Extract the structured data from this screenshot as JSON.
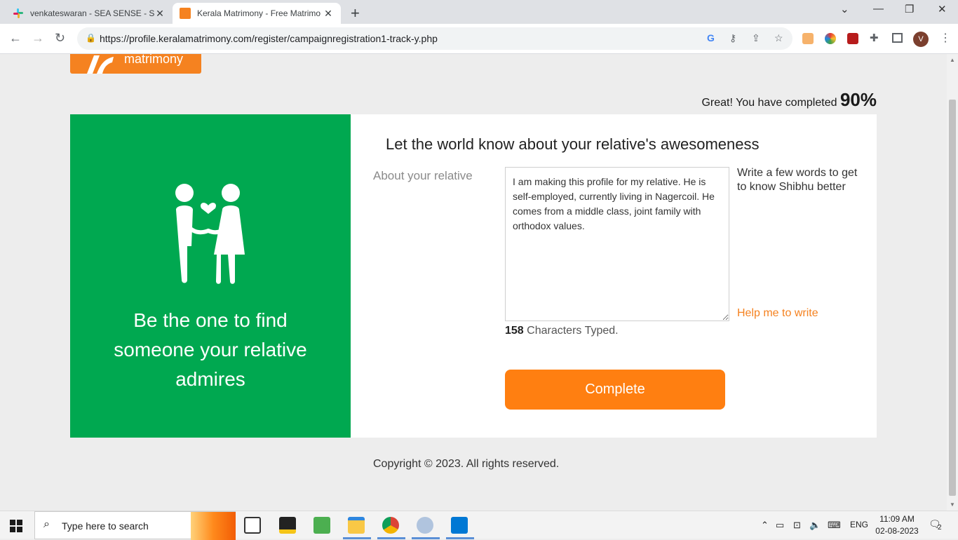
{
  "browser": {
    "tabs": [
      {
        "title": "venkateswaran - SEA SENSE - Sla",
        "favicon": "slack-icon"
      },
      {
        "title": "Kerala Matrimony - Free Matrimo",
        "favicon": "kerala-matrimony-icon"
      }
    ],
    "url": "https://profile.keralamatrimony.com/register/campaignregistration1-track-y.php",
    "profile_initial": "V"
  },
  "page": {
    "logo_text": "matrimony",
    "progress_prefix": "Great! You have completed",
    "progress_value": "90%",
    "left_tagline": "Be the one to find someone your relative admires",
    "heading": "Let the world know about your relative's awesomeness",
    "field_label": "About your relative",
    "about_text": "I am making this profile for my relative. He is self-employed, currently living in Nagercoil. He comes from a middle class, joint family with orthodox values.",
    "hint": "Write a few words to get to know Shibhu better",
    "help_link": "Help me to write",
    "char_count": "158",
    "char_count_suffix": "Characters Typed.",
    "complete_button": "Complete",
    "copyright": "Copyright © 2023. All rights reserved."
  },
  "taskbar": {
    "search_placeholder": "Type here to search",
    "language": "ENG",
    "time": "11:09 AM",
    "date": "02-08-2023",
    "notification_count": "2"
  },
  "colors": {
    "brand_orange": "#ff7f11",
    "brand_green": "#00a850"
  }
}
